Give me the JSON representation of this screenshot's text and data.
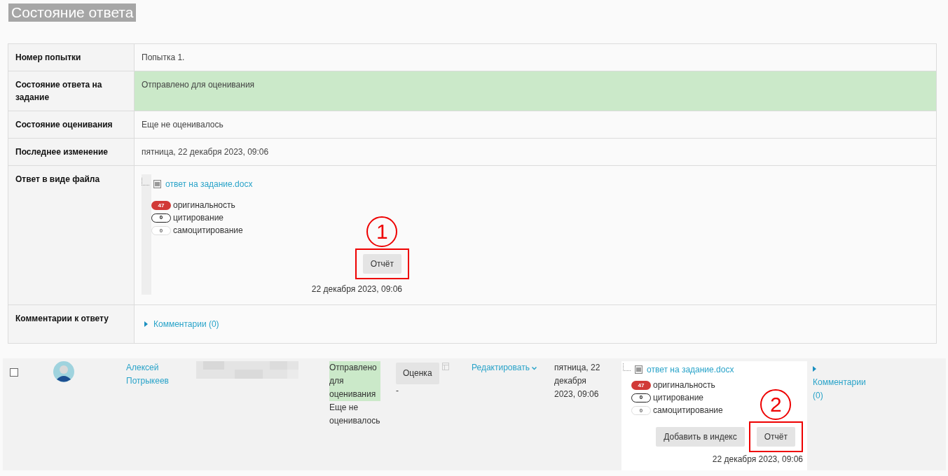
{
  "heading": "Состояние ответа",
  "summary": {
    "rows": [
      {
        "label": "Номер попытки",
        "kind": "text",
        "value": "Попытка 1.",
        "highlight": false
      },
      {
        "label": "Состояние ответа на задание",
        "kind": "text",
        "value": "Отправлено для оценивания",
        "highlight": true
      },
      {
        "label": "Состояние оценивания",
        "kind": "text",
        "value": "Еще не оценивалось",
        "highlight": false
      },
      {
        "label": "Последнее изменение",
        "kind": "text",
        "value": "пятница, 22 декабря 2023, 09:06",
        "highlight": false
      },
      {
        "label": "Ответ в виде файла",
        "kind": "file",
        "file": {
          "name": "ответ на задание.docx",
          "scores": [
            {
              "kind": "originality",
              "value": "47",
              "label": "оригинальность"
            },
            {
              "kind": "citation",
              "value": "0",
              "label": "цитирование"
            },
            {
              "kind": "self",
              "value": "0",
              "label": "самоцитирование"
            }
          ],
          "buttons": [
            "Отчёт"
          ],
          "date": "22 декабря 2023, 09:06",
          "callout": "1"
        }
      },
      {
        "label": "Комментарии к ответу",
        "kind": "comments",
        "value": "Комментарии (0)"
      }
    ]
  },
  "grading": {
    "checked": false,
    "name": "Алексей Потрыкеев",
    "status": "Отправлено для оценивания",
    "status_highlight": true,
    "grading_status": "Еще не оценивалось",
    "grade_button": "Оценка",
    "grade": "-",
    "edit_menu": "Редактировать",
    "modified": "пятница, 22 декабря 2023, 09:06",
    "file": {
      "name": "ответ на задание.docx",
      "scores": [
        {
          "kind": "originality",
          "value": "47",
          "label": "оригинальность"
        },
        {
          "kind": "citation",
          "value": "0",
          "label": "цитирование"
        },
        {
          "kind": "self",
          "value": "0",
          "label": "самоцитирование"
        }
      ],
      "buttons": [
        "Добавить в индекс",
        "Отчёт"
      ],
      "date": "22 декабря 2023, 09:06",
      "callout": "2"
    },
    "comments": "Комментарии (0)"
  }
}
